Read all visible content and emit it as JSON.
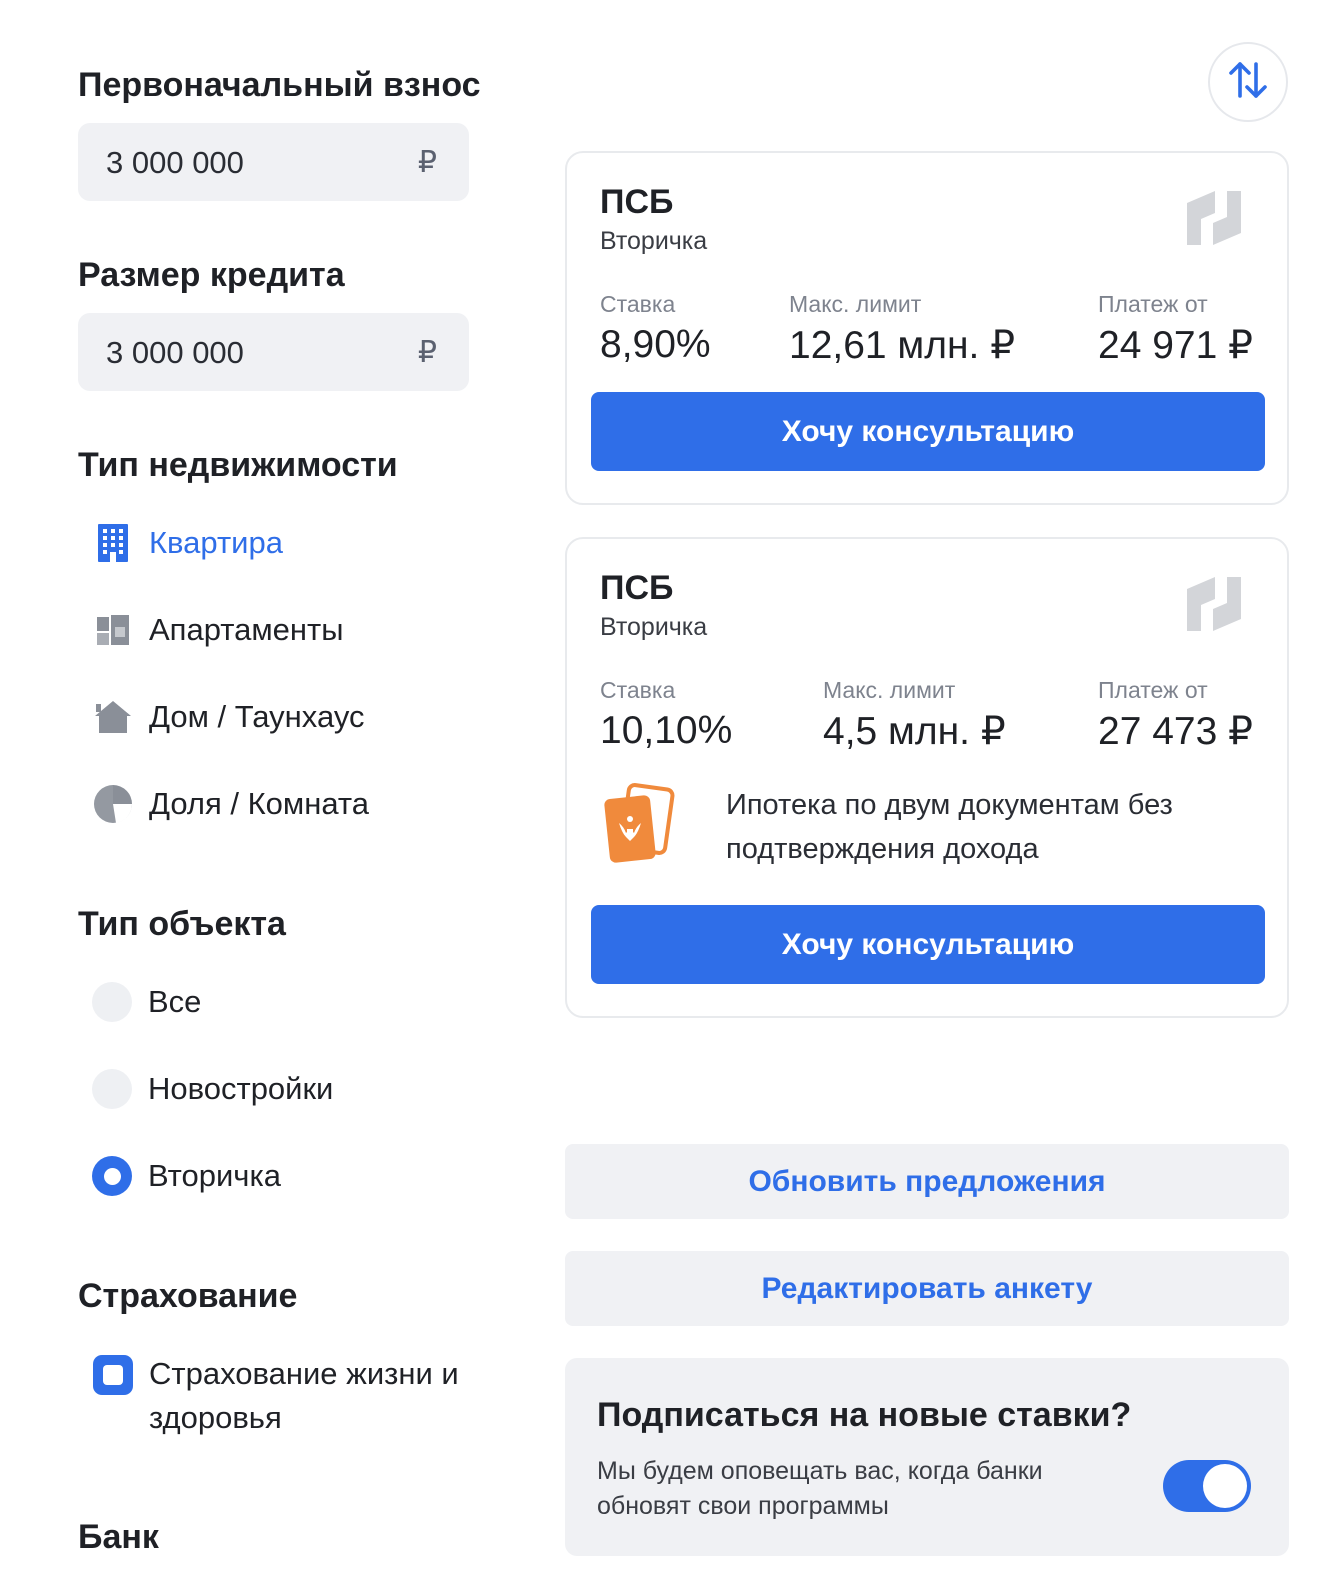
{
  "form": {
    "down_payment": {
      "label": "Первоначальный взнос",
      "value": "3 000 000",
      "currency": "₽"
    },
    "loan_amount": {
      "label": "Размер кредита",
      "value": "3 000 000",
      "currency": "₽"
    },
    "property_type": {
      "label": "Тип недвижимости",
      "options": [
        {
          "label": "Квартира",
          "icon": "building-icon",
          "selected": true
        },
        {
          "label": "Апартаменты",
          "icon": "apartments-icon",
          "selected": false
        },
        {
          "label": "Дом / Таунхаус",
          "icon": "house-icon",
          "selected": false
        },
        {
          "label": "Доля / Комната",
          "icon": "pie-share-icon",
          "selected": false
        }
      ]
    },
    "object_type": {
      "label": "Тип объекта",
      "options": [
        {
          "label": "Все",
          "selected": false
        },
        {
          "label": "Новостройки",
          "selected": false
        },
        {
          "label": "Вторичка",
          "selected": true
        }
      ]
    },
    "insurance": {
      "label": "Страхование",
      "option": "Страхование жизни и здоровья",
      "checked": true
    },
    "bank": {
      "label": "Банк"
    }
  },
  "offers": [
    {
      "bank": "ПСБ",
      "kind": "Вторичка",
      "rate_label": "Ставка",
      "rate": "8,90%",
      "limit_label": "Макс. лимит",
      "limit": "12,61 млн. ₽",
      "payment_label": "Платеж от",
      "payment": "24 971 ₽",
      "cta": "Хочу консультацию"
    },
    {
      "bank": "ПСБ",
      "kind": "Вторичка",
      "rate_label": "Ставка",
      "rate": "10,10%",
      "limit_label": "Макс. лимит",
      "limit": "4,5 млн. ₽",
      "payment_label": "Платеж от",
      "payment": "27 473 ₽",
      "feature": "Ипотека по двум документам без подтверждения дохода",
      "feature_icon": "documents-icon",
      "cta": "Хочу консультацию"
    }
  ],
  "actions": {
    "refresh": "Обновить предложения",
    "edit": "Редактировать анкету"
  },
  "subscribe": {
    "title": "Подписаться на новые ставки?",
    "description": "Мы будем оповещать вас, когда банки обновят свои программы",
    "enabled": true
  },
  "colors": {
    "accent": "#2f6ee8",
    "field_bg": "#f0f1f4",
    "doc_orange": "#f08a3c"
  }
}
